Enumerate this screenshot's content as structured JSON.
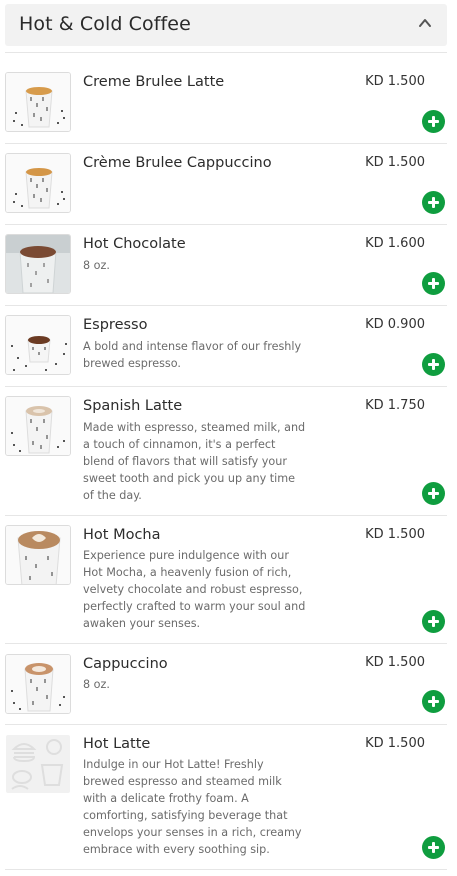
{
  "section": {
    "title": "Hot & Cold Coffee",
    "collapse_icon": "chevron-up-icon"
  },
  "items": [
    {
      "name": "Creme Brulee Latte",
      "price": "KD 1.500",
      "description": "",
      "image": "cup-icon",
      "add_icon": "plus-icon"
    },
    {
      "name": "Crème Brulee Cappuccino",
      "price": "KD 1.500",
      "description": "",
      "image": "cup-icon",
      "add_icon": "plus-icon"
    },
    {
      "name": "Hot Chocolate",
      "price": "KD 1.600",
      "description": "8 oz.",
      "image": "cup-icon",
      "add_icon": "plus-icon"
    },
    {
      "name": "Espresso",
      "price": "KD 0.900",
      "description": "A bold and intense flavor of our freshly brewed espresso.",
      "image": "cup-icon",
      "add_icon": "plus-icon"
    },
    {
      "name": "Spanish Latte",
      "price": "KD 1.750",
      "description": "Made with espresso, steamed milk, and a touch of cinnamon, it's a perfect blend of flavors that will satisfy your sweet tooth and pick you up any time of the day.",
      "image": "cup-icon",
      "add_icon": "plus-icon"
    },
    {
      "name": "Hot Mocha",
      "price": "KD 1.500",
      "description": "Experience pure indulgence with our Hot Mocha, a heavenly fusion of rich, velvety chocolate and robust espresso, perfectly crafted to warm your soul and awaken your senses.",
      "image": "cup-icon",
      "add_icon": "plus-icon"
    },
    {
      "name": "Cappuccino",
      "price": "KD 1.500",
      "description": "8 oz.",
      "image": "cup-icon",
      "add_icon": "plus-icon"
    },
    {
      "name": "Hot Latte",
      "price": "KD 1.500",
      "description": "Indulge in our Hot Latte! Freshly brewed espresso and steamed milk with a delicate frothy foam. A comforting, satisfying beverage that envelops your senses in a rich, creamy embrace with every soothing sip.",
      "image": "placeholder-food-icon",
      "add_icon": "plus-icon"
    }
  ],
  "colors": {
    "add_button": "#0f9d3f",
    "header_bg": "#f2f2f2",
    "divider": "#e6e6e6"
  }
}
